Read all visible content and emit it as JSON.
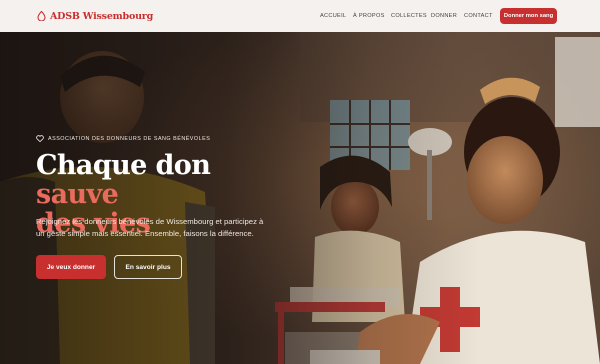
{
  "header": {
    "logo_text": "ADSB Wissembourg",
    "logo_icon": "blood-drop-icon",
    "nav": [
      "ACCUEIL",
      "À PROPOS",
      "COLLECTES",
      "DONNER",
      "CONTACT"
    ],
    "cta": "Donner mon sang"
  },
  "hero": {
    "tagline": "ASSOCIATION DES DONNEURS DE SANG BÉNÉVOLES",
    "tagline_icon": "heart-icon",
    "title_part1": "Chaque don ",
    "title_accent1": "sauve",
    "title_accent2": "des vies",
    "description": "Rejoignez les donneurs bénévoles de Wissembourg et participez à un geste simple mais essentiel. Ensemble, faisons la différence.",
    "primary_button": "Je veux donner",
    "secondary_button": "En savoir plus"
  },
  "colors": {
    "brand": "#c8302f",
    "accent_title": "#ea6a5e",
    "header_bg": "#f4f1ee"
  }
}
